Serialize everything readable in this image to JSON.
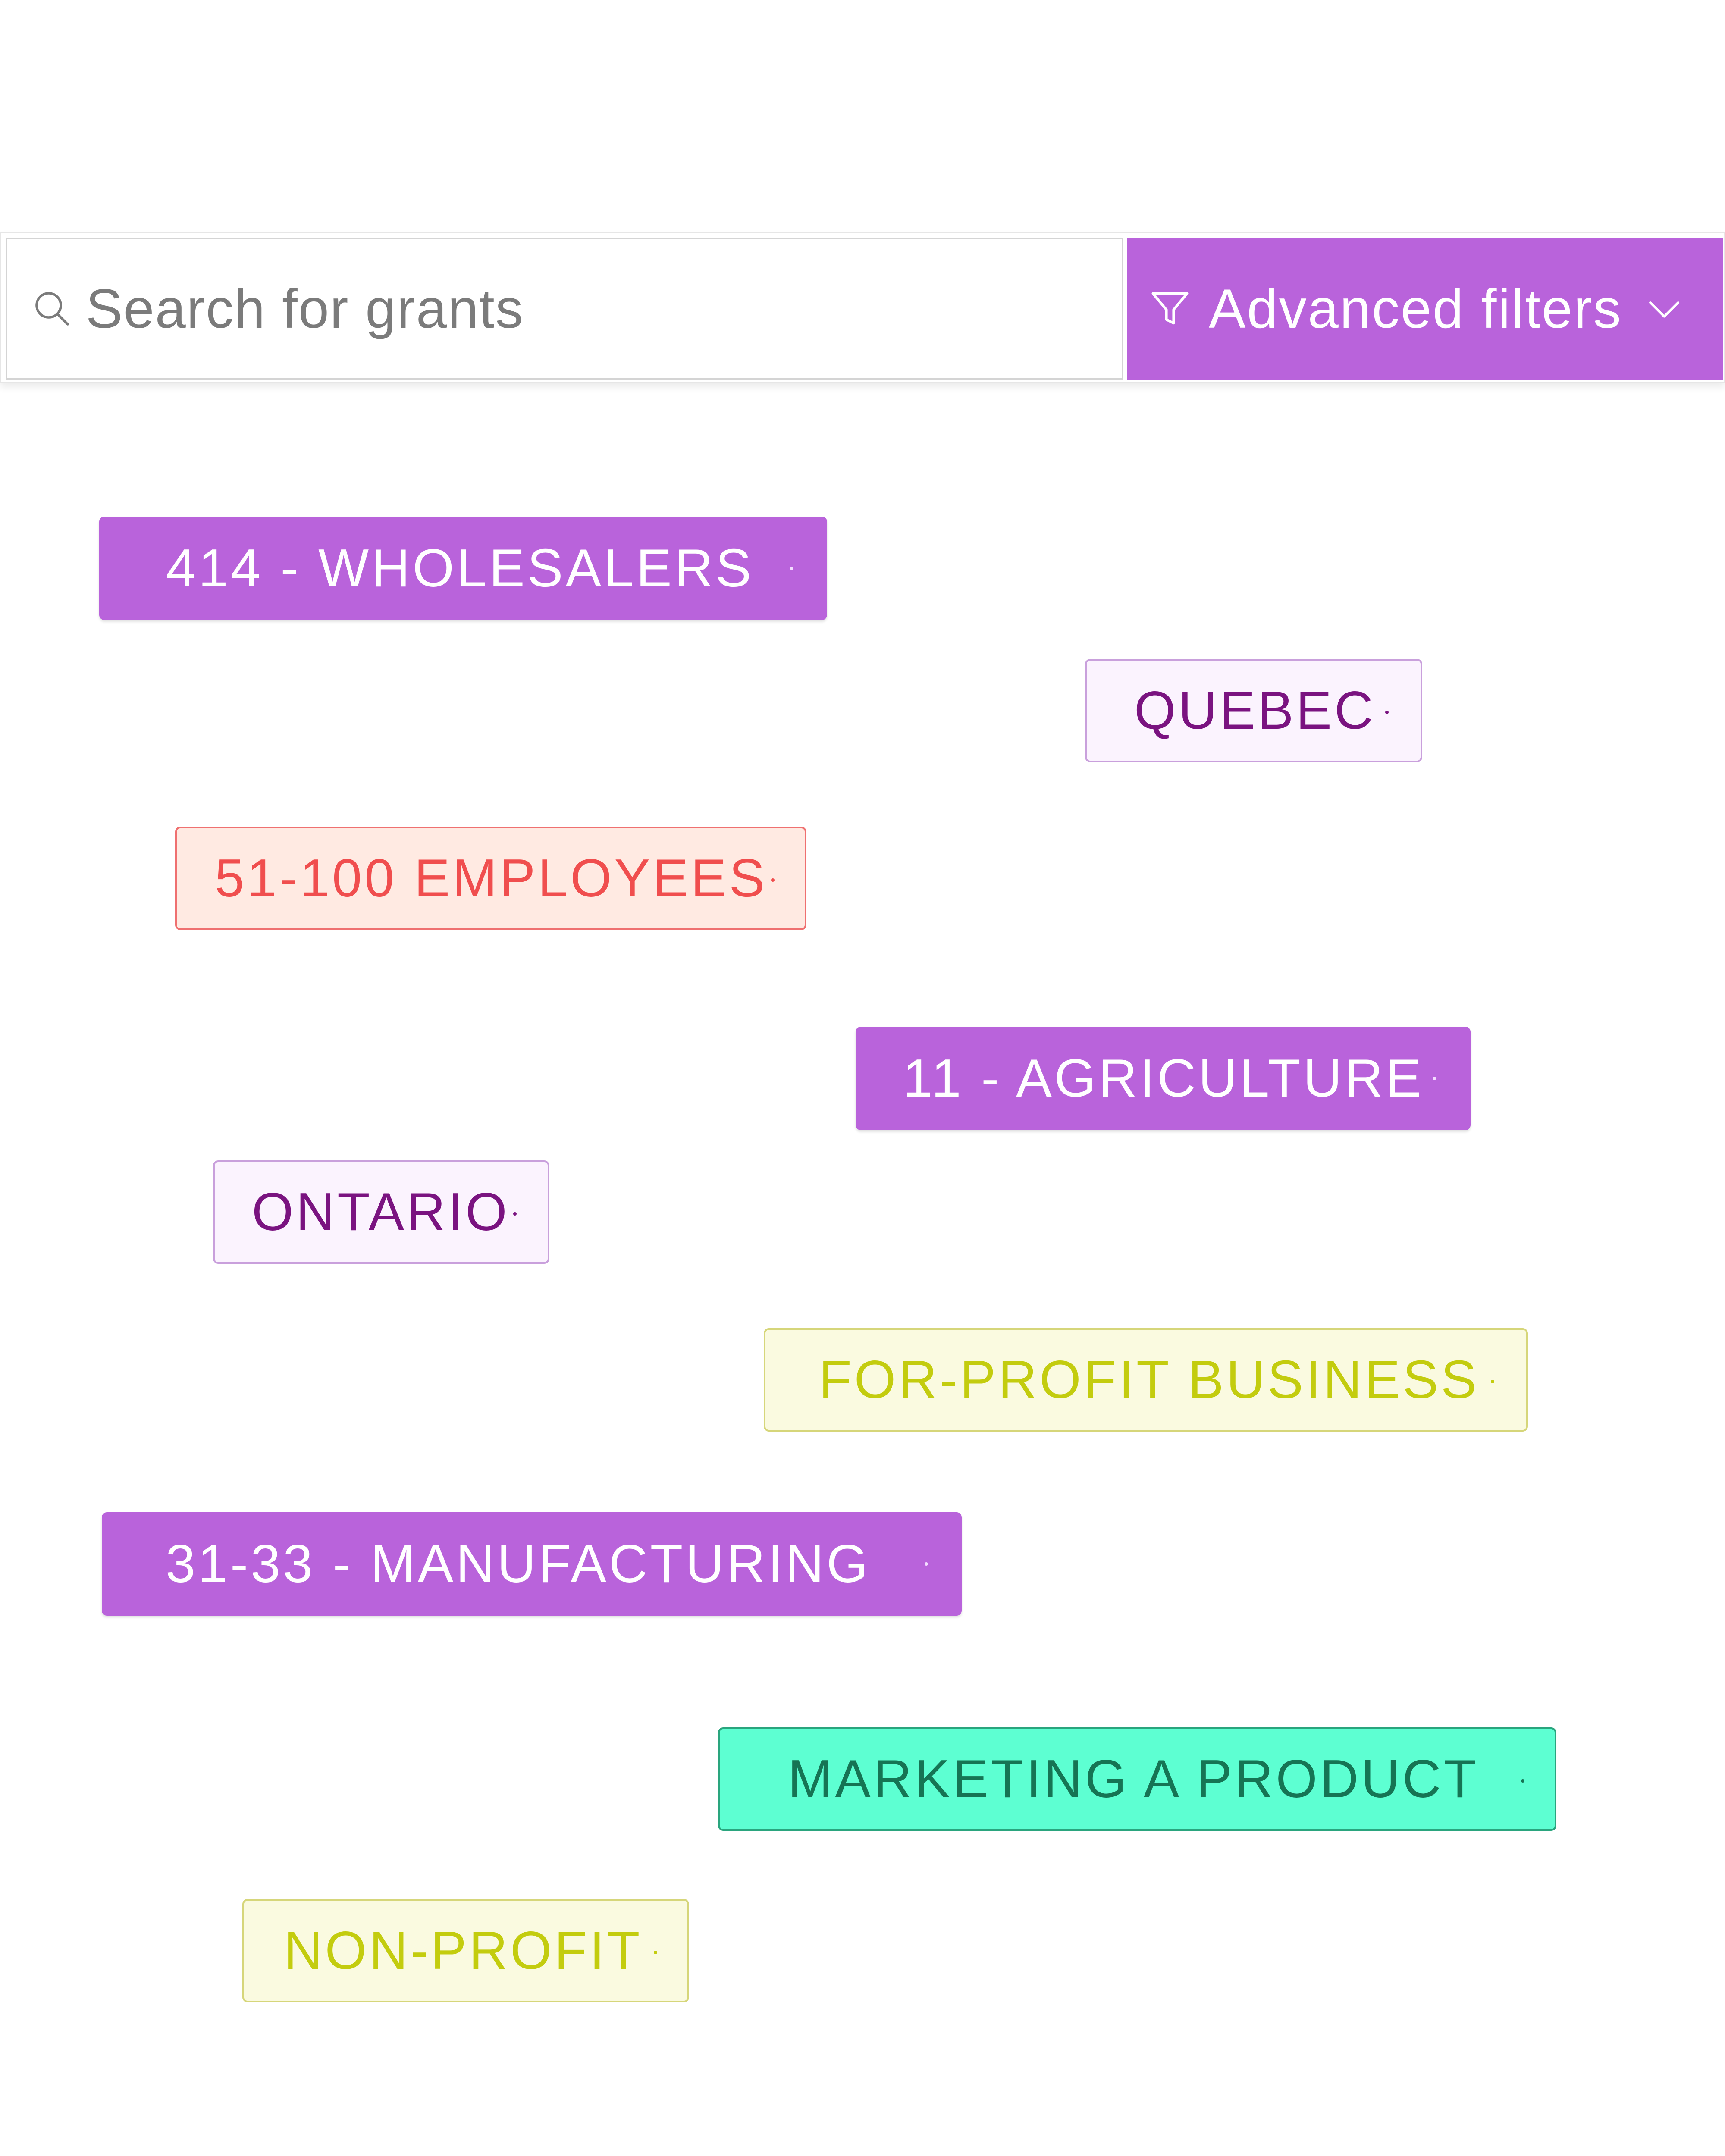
{
  "search": {
    "placeholder": "Search for grants",
    "icon": "search-icon"
  },
  "filters_button": {
    "label": "Advanced filters",
    "icon": "filter-icon",
    "dropdown_icon": "chevron-down-icon",
    "color": "#b963db"
  },
  "tags": {
    "wholesalers": "414 - WHOLESALERS",
    "quebec": "QUEBEC",
    "employees": "51-100 EMPLOYEES",
    "agriculture": "11 - AGRICULTURE",
    "ontario": "ONTARIO",
    "for_profit": "FOR-PROFIT BUSINESS",
    "manufacturing": "31-33 - MANUFACTURING",
    "marketing": "MARKETING A PRODUCT",
    "non_profit": "NON-PROFIT"
  },
  "colors": {
    "industry": "#b963db",
    "province": "#7a1380",
    "size": "#f04e4e",
    "organization_type": "#c3cc0e",
    "purpose": "#5dffd2"
  }
}
